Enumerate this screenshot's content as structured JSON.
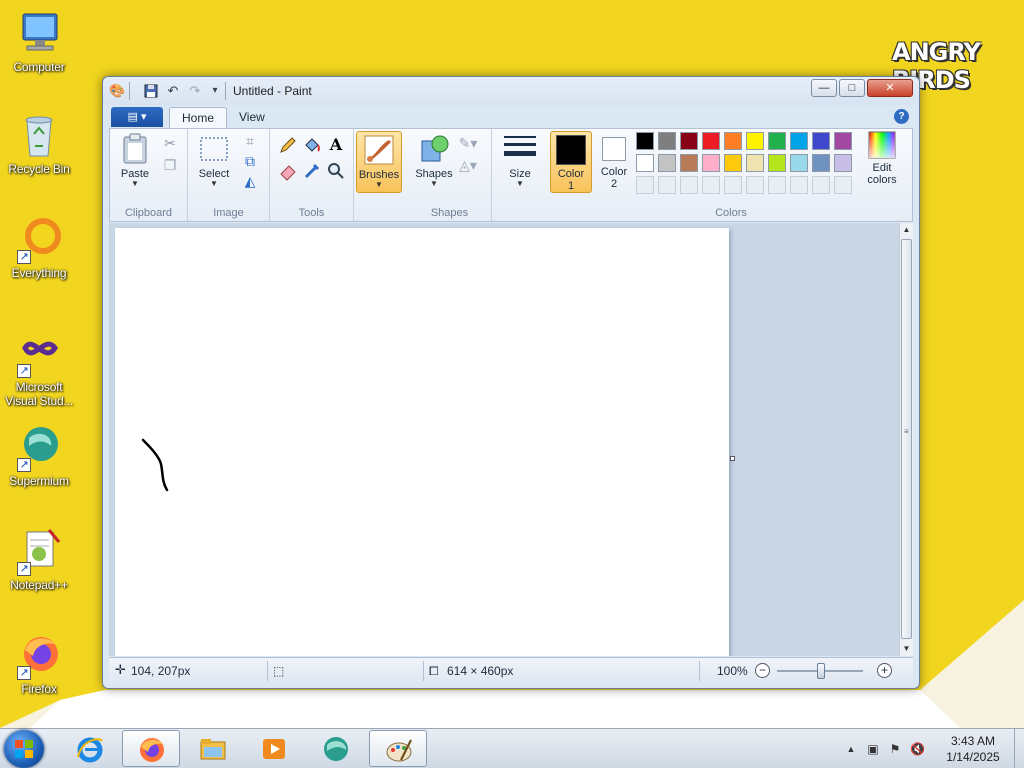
{
  "desktop": {
    "brand": "ANGRY BIRDS",
    "icons": [
      {
        "label": "Computer"
      },
      {
        "label": "Recycle Bin"
      },
      {
        "label": "Everything"
      },
      {
        "label": "Microsoft Visual Stud..."
      },
      {
        "label": "Supermium"
      },
      {
        "label": "Notepad++"
      },
      {
        "label": "Firefox"
      }
    ]
  },
  "window": {
    "title": "Untitled - Paint",
    "buttons": {
      "minimize": "—",
      "maximize": "□",
      "close": "✕"
    }
  },
  "ribbon": {
    "tabs": {
      "home": "Home",
      "view": "View"
    },
    "help": "?",
    "groups": {
      "clipboard": {
        "label": "Clipboard",
        "paste": "Paste"
      },
      "image": {
        "label": "Image",
        "select": "Select"
      },
      "tools": {
        "label": "Tools"
      },
      "brushes": {
        "label": "Brushes"
      },
      "shapes": {
        "label": "Shapes",
        "button": "Shapes"
      },
      "size": {
        "label": "Size"
      },
      "colors": {
        "label": "Colors",
        "color1_line1": "Color",
        "color1_line2": "1",
        "color2_line1": "Color",
        "color2_line2": "2",
        "edit_line1": "Edit",
        "edit_line2": "colors",
        "color1": "#000000",
        "color2": "#ffffff",
        "palette_row1": [
          "#000000",
          "#7f7f7f",
          "#880015",
          "#ed1c24",
          "#ff7f27",
          "#fff200",
          "#22b14c",
          "#00a2e8",
          "#3f48cc",
          "#a349a4"
        ],
        "palette_row2": [
          "#ffffff",
          "#c3c3c3",
          "#b97a57",
          "#ffaec9",
          "#ffc90e",
          "#efe4b0",
          "#b5e61d",
          "#99d9ea",
          "#7092be",
          "#c8bfe7"
        ]
      }
    }
  },
  "status": {
    "cursor_pos": "104, 207px",
    "image_size": "614 × 460px",
    "zoom": "100%"
  },
  "taskbar": {
    "time": "3:43 AM",
    "date": "1/14/2025"
  }
}
